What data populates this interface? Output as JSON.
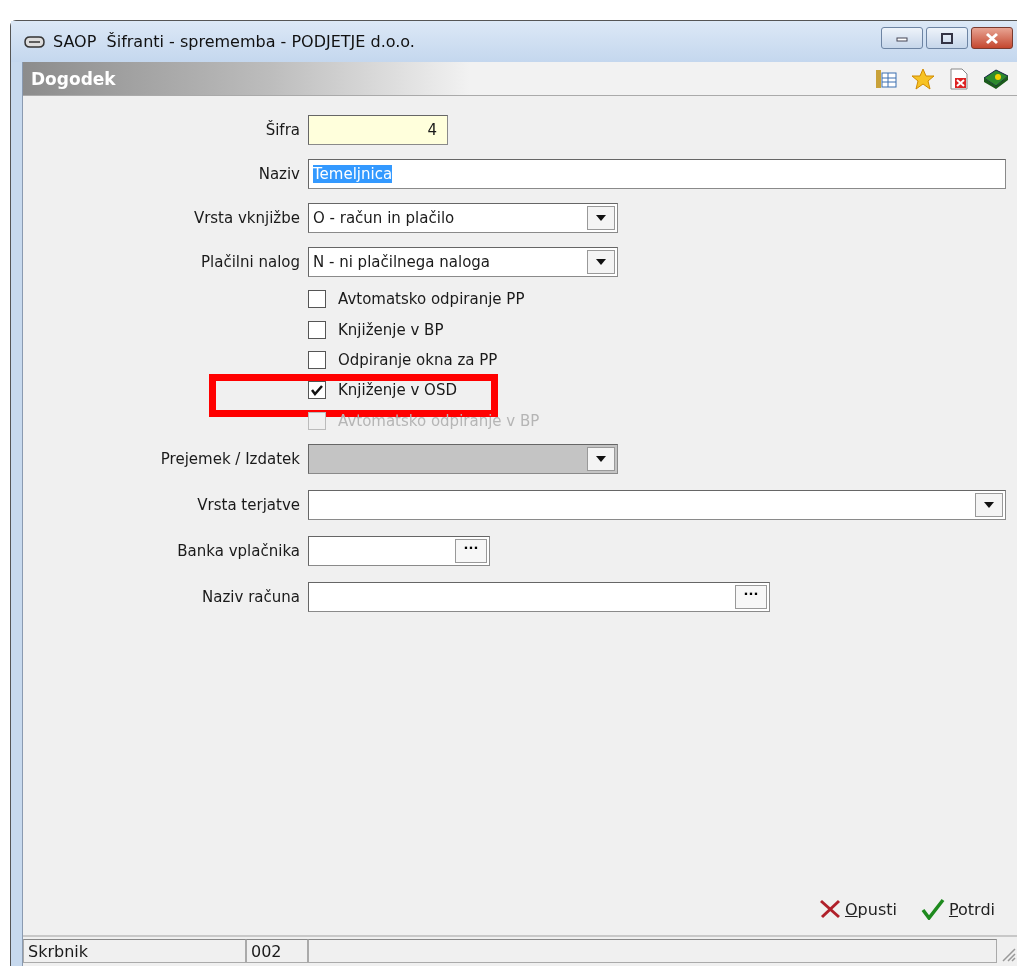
{
  "window": {
    "title": "SAOP  Šifranti - sprememba - PODJETJE d.o.o."
  },
  "header": {
    "title": "Dogodek"
  },
  "fields": [
    {
      "kind": "code",
      "label": "Šifra",
      "value": "4"
    },
    {
      "kind": "text",
      "label": "Naziv",
      "value": "Temeljnica",
      "value_selected": true
    },
    {
      "kind": "combo",
      "label": "Vrsta vknjižbe",
      "value": "O - račun in plačilo",
      "disabled": false
    },
    {
      "kind": "combo",
      "label": "Plačilni nalog",
      "value": "N - ni plačilnega naloga",
      "disabled": false
    },
    {
      "kind": "checkbox",
      "label": "Avtomatsko odpiranje PP",
      "checked": false,
      "disabled": false,
      "highlighted": false
    },
    {
      "kind": "checkbox",
      "label": "Knjiženje v BP",
      "checked": false,
      "disabled": false,
      "highlighted": false
    },
    {
      "kind": "checkbox",
      "label": "Odpiranje okna za PP",
      "checked": false,
      "disabled": false,
      "highlighted": false
    },
    {
      "kind": "checkbox",
      "label": "Knjiženje v OSD",
      "checked": true,
      "disabled": false,
      "highlighted": true
    },
    {
      "kind": "checkbox",
      "label": "Avtomatsko odpiranje v BP",
      "checked": false,
      "disabled": true,
      "highlighted": false
    },
    {
      "kind": "combo",
      "label": "Prejemek / Izdatek",
      "disabled": true
    },
    {
      "kind": "combo",
      "label": "Vrsta terjatve",
      "disabled": false
    },
    {
      "kind": "lookup",
      "label": "Banka vplačnika",
      "button": "···"
    },
    {
      "kind": "lookup",
      "label": "Naziv računa",
      "button": "···"
    }
  ],
  "buttons": [
    {
      "kind": "cancel",
      "label": "Opusti"
    },
    {
      "kind": "confirm",
      "label": "Potrdi"
    }
  ],
  "status_bar": {
    "user": "Skrbnik",
    "code": "002"
  }
}
